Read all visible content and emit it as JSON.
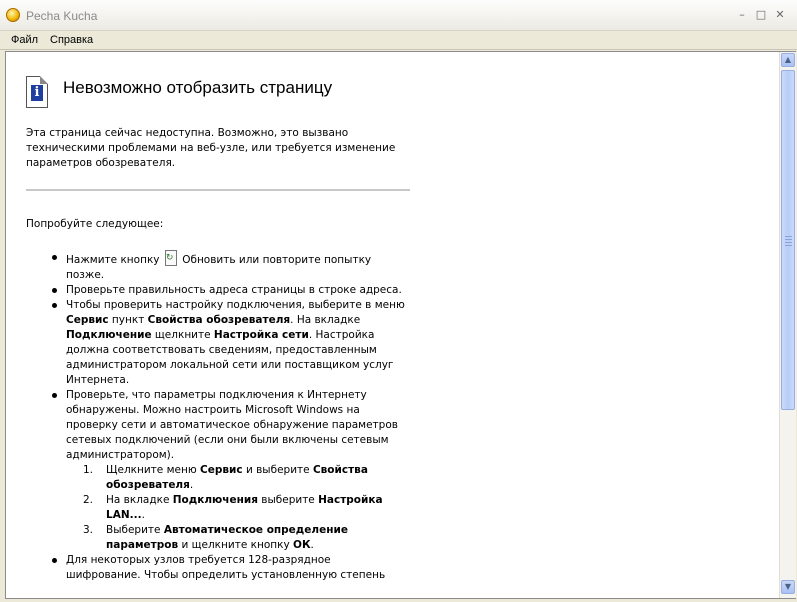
{
  "window": {
    "title": "Pecha Kucha",
    "controls": {
      "minimize": "–",
      "maximize": "□",
      "close": "✕"
    }
  },
  "menu": {
    "file": "Файл",
    "help": "Справка"
  },
  "page": {
    "heading": "Невозможно отобразить страницу",
    "description": "Эта страница сейчас недоступна. Возможно, это вызвано техническими проблемами на веб-узле, или требуется изменение параметров обозревателя.",
    "try_label": "Попробуйте следующее:",
    "bullet1": {
      "before": "Нажмите кнопку",
      "after": "Обновить или повторите попытку позже."
    },
    "bullet2": "Проверьте правильность адреса страницы в строке адреса.",
    "bullet3": {
      "t1": "Чтобы проверить настройку подключения, выберите в меню ",
      "b1": "Сервис",
      "t2": " пункт ",
      "b2": "Свойства обозревателя",
      "t3": ". На вкладке ",
      "b3": "Подключение",
      "t4": " щелкните ",
      "b4": "Настройка сети",
      "t5": ". Настройка должна соответствовать сведениям, предоставленным администратором локальной сети или поставщиком услуг Интернета."
    },
    "bullet4": {
      "text": "Проверьте, что параметры подключения к Интернету обнаружены. Можно настроить Microsoft Windows на проверку сети и автоматическое обнаружение параметров сетевых подключений (если они были включены сетевым администратором).",
      "steps": [
        {
          "num": "1.",
          "t1": "Щелкните меню ",
          "b1": "Сервис",
          "t2": " и выберите ",
          "b2": "Свойства обозревателя",
          "t3": "."
        },
        {
          "num": "2.",
          "t1": "На вкладке ",
          "b1": "Подключения",
          "t2": " выберите ",
          "b2": "Настройка LAN...",
          "t3": "."
        },
        {
          "num": "3.",
          "t1": "Выберите ",
          "b1": "Автоматическое определение параметров",
          "t2": " и щелкните кнопку ",
          "b2": "ОК",
          "t3": "."
        }
      ]
    },
    "bullet5": "Для некоторых узлов требуется 128-разрядное шифрование. Чтобы определить установленную степень"
  },
  "icons": {
    "app": "app-logo-icon",
    "info": "info-icon",
    "refresh": "refresh-icon"
  }
}
